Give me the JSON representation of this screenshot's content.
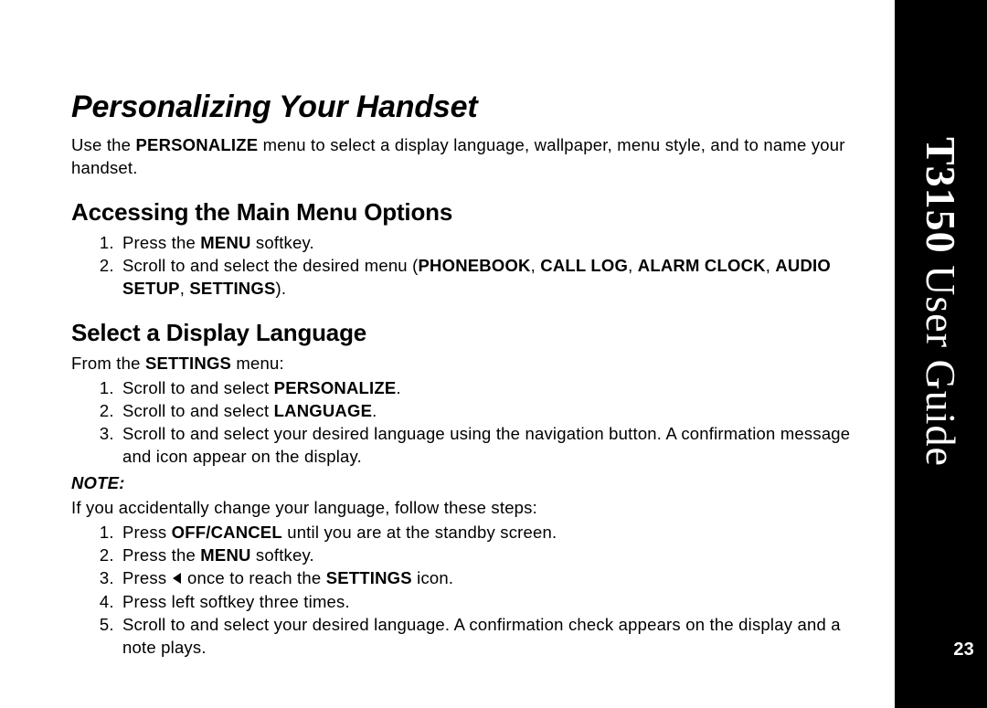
{
  "side": {
    "title_bold": "T3150",
    "title_rest": " User Guide",
    "page_number": "23"
  },
  "main": {
    "h1": "Personalizing Your Handset",
    "intro_1": "Use the ",
    "intro_bold": "PERSONALIZE",
    "intro_2": " menu to select a display language, wallpaper, menu style, and to name your handset.",
    "secA": {
      "title": "Accessing the Main Menu Options",
      "li1_a": "Press the ",
      "li1_b": "MENU",
      "li1_c": " softkey.",
      "li2_a": "Scroll to and select the desired menu (",
      "li2_b": "PHONEBOOK",
      "li2_c": ", ",
      "li2_d": "CALL LOG",
      "li2_e": ", ",
      "li2_f": "ALARM CLOCK",
      "li2_g": ", ",
      "li2_h": "AUDIO SETUP",
      "li2_i": ", ",
      "li2_j": "SETTINGS",
      "li2_k": ")."
    },
    "secB": {
      "title": "Select a Display Language",
      "from_a": "From the ",
      "from_b": "SETTINGS",
      "from_c": " menu:",
      "li1_a": "Scroll to and select ",
      "li1_b": "PERSONALIZE",
      "li1_c": ".",
      "li2_a": "Scroll to and select ",
      "li2_b": "LANGUAGE",
      "li2_c": ".",
      "li3": "Scroll to and select your desired language using the navigation button. A confirmation message and icon appear on the display.",
      "note_label": "NOTE:",
      "note_intro": "If you accidentally change your language, follow these steps:",
      "n1_a": "Press ",
      "n1_b": "OFF/CANCEL",
      "n1_c": " until you are at the standby screen.",
      "n2_a": "Press the ",
      "n2_b": "MENU",
      "n2_c": " softkey.",
      "n3_a": "Press ",
      "n3_b": " once to reach the ",
      "n3_c": "SETTINGS",
      "n3_d": " icon.",
      "n4": "Press left softkey three times.",
      "n5": "Scroll to and select your desired language. A confirmation check appears on the display and a note plays."
    }
  }
}
